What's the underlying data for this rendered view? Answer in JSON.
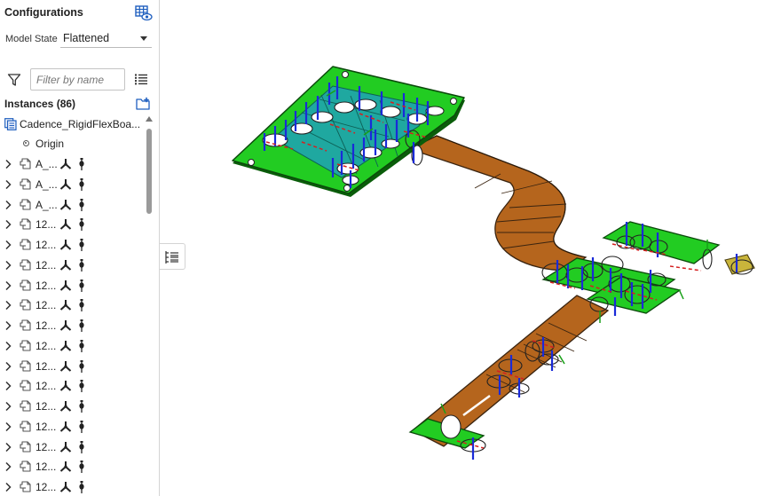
{
  "configurations": {
    "title": "Configurations",
    "model_state_label": "Model State",
    "model_state_value": "Flattened"
  },
  "filter": {
    "placeholder": "Filter by name"
  },
  "instances": {
    "title": "Instances (86)",
    "root_label": "Cadence_RigidFlexBoa...",
    "origin_label": "Origin",
    "items": [
      {
        "label": "A_..."
      },
      {
        "label": "A_..."
      },
      {
        "label": "A_..."
      },
      {
        "label": "12..."
      },
      {
        "label": "12..."
      },
      {
        "label": "12..."
      },
      {
        "label": "12..."
      },
      {
        "label": "12..."
      },
      {
        "label": "12..."
      },
      {
        "label": "12..."
      },
      {
        "label": "12..."
      },
      {
        "label": "12..."
      },
      {
        "label": "12..."
      },
      {
        "label": "12..."
      },
      {
        "label": "12..."
      },
      {
        "label": "12..."
      },
      {
        "label": "12..."
      }
    ]
  },
  "colors": {
    "rigid_board": "#22cc22",
    "flex_board": "#b5651d",
    "accent": "#1f5fbf",
    "axis_blue": "#1a2ad8",
    "axis_red": "#d42020",
    "axis_green": "#18a018"
  },
  "icons": {
    "config": "config-table-eye-icon",
    "filter": "filter-funnel-icon",
    "list_view": "list-view-icon",
    "add_folder": "add-folder-icon",
    "assembly": "assembly-icon",
    "part": "part-icon",
    "mate": "mate-connector-icon",
    "pin": "pin-icon",
    "side_tab": "feature-list-icon"
  }
}
